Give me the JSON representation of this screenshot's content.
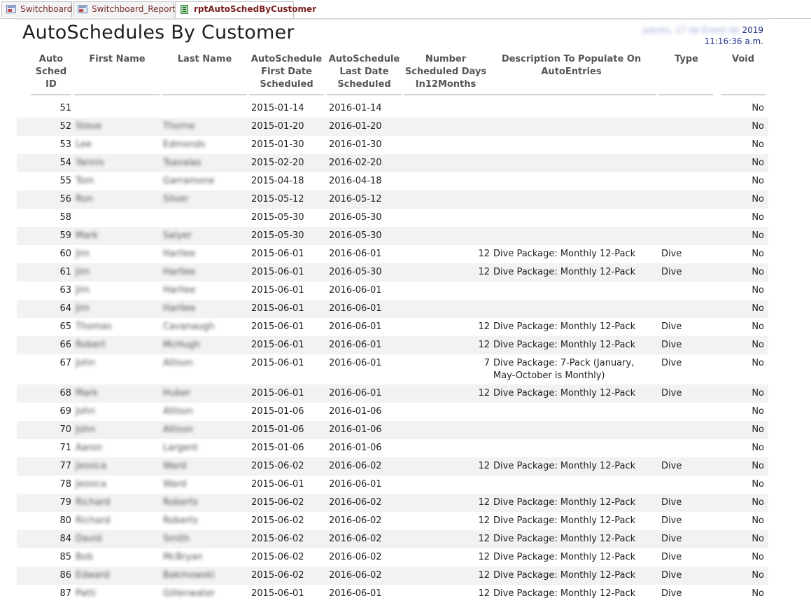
{
  "tabs": [
    {
      "label": "Switchboard",
      "type": "form"
    },
    {
      "label": "Switchboard_Reports",
      "type": "form"
    },
    {
      "label": "rptAutoSchedByCustomer",
      "type": "report",
      "active": true
    }
  ],
  "report": {
    "title": "AutoSchedules By Customer",
    "date_year": "2019",
    "date_blurred": "jueves, 17 de Enero de",
    "time": "11:16:36 a.m."
  },
  "columns": {
    "id": [
      "Auto",
      "Sched",
      "ID"
    ],
    "first": [
      "First Name"
    ],
    "last": [
      "Last Name"
    ],
    "first_date": [
      "AutoSchedule",
      "First Date",
      "Scheduled"
    ],
    "last_date": [
      "AutoSchedule",
      "Last Date",
      "Scheduled"
    ],
    "days": [
      "Number",
      "Scheduled Days",
      "In12Months"
    ],
    "desc": [
      "Description To Populate On",
      "AutoEntries"
    ],
    "type": [
      "Type"
    ],
    "void": [
      "Void"
    ]
  },
  "rows": [
    {
      "id": "51",
      "first": "",
      "last": "",
      "d1": "2015-01-14",
      "d2": "2016-01-14",
      "days": "",
      "desc": "",
      "type": "",
      "void": "No"
    },
    {
      "id": "52",
      "first": "Steve",
      "last": "Thorne",
      "d1": "2015-01-20",
      "d2": "2016-01-20",
      "days": "",
      "desc": "",
      "type": "",
      "void": "No"
    },
    {
      "id": "53",
      "first": "Lee",
      "last": "Edmonds",
      "d1": "2015-01-30",
      "d2": "2016-01-30",
      "days": "",
      "desc": "",
      "type": "",
      "void": "No"
    },
    {
      "id": "54",
      "first": "Yannis",
      "last": "Tsavalas",
      "d1": "2015-02-20",
      "d2": "2016-02-20",
      "days": "",
      "desc": "",
      "type": "",
      "void": "No"
    },
    {
      "id": "55",
      "first": "Tom",
      "last": "Garramone",
      "d1": "2015-04-18",
      "d2": "2016-04-18",
      "days": "",
      "desc": "",
      "type": "",
      "void": "No"
    },
    {
      "id": "56",
      "first": "Ron",
      "last": "Silver",
      "d1": "2015-05-12",
      "d2": "2016-05-12",
      "days": "",
      "desc": "",
      "type": "",
      "void": "No"
    },
    {
      "id": "58",
      "first": "",
      "last": "",
      "d1": "2015-05-30",
      "d2": "2016-05-30",
      "days": "",
      "desc": "",
      "type": "",
      "void": "No"
    },
    {
      "id": "59",
      "first": "Mark",
      "last": "Salyer",
      "d1": "2015-05-30",
      "d2": "2016-05-30",
      "days": "",
      "desc": "",
      "type": "",
      "void": "No"
    },
    {
      "id": "60",
      "first": "Jim",
      "last": "Harllee",
      "d1": "2015-06-01",
      "d2": "2016-06-01",
      "days": "12",
      "desc": "Dive Package: Monthly 12-Pack",
      "type": "Dive",
      "void": "No"
    },
    {
      "id": "61",
      "first": "Jim",
      "last": "Harllee",
      "d1": "2015-06-01",
      "d2": "2016-05-30",
      "days": "12",
      "desc": "Dive Package: Monthly 12-Pack",
      "type": "Dive",
      "void": "No"
    },
    {
      "id": "63",
      "first": "Jim",
      "last": "Harllee",
      "d1": "2015-06-01",
      "d2": "2016-06-01",
      "days": "",
      "desc": "",
      "type": "",
      "void": "No"
    },
    {
      "id": "64",
      "first": "Jim",
      "last": "Harllee",
      "d1": "2015-06-01",
      "d2": "2016-06-01",
      "days": "",
      "desc": "",
      "type": "",
      "void": "No"
    },
    {
      "id": "65",
      "first": "Thomas",
      "last": "Cavanaugh",
      "d1": "2015-06-01",
      "d2": "2016-06-01",
      "days": "12",
      "desc": "Dive Package: Monthly 12-Pack",
      "type": "Dive",
      "void": "No"
    },
    {
      "id": "66",
      "first": "Robert",
      "last": "McHugh",
      "d1": "2015-06-01",
      "d2": "2016-06-01",
      "days": "12",
      "desc": "Dive Package: Monthly 12-Pack",
      "type": "Dive",
      "void": "No"
    },
    {
      "id": "67",
      "first": "John",
      "last": "Allison",
      "d1": "2015-06-01",
      "d2": "2016-06-01",
      "days": "7",
      "desc": "Dive Package: 7-Pack (January, May-October is Monthly)",
      "type": "Dive",
      "void": "No",
      "tall": true
    },
    {
      "id": "68",
      "first": "Mark",
      "last": "Huber",
      "d1": "2015-06-01",
      "d2": "2016-06-01",
      "days": "12",
      "desc": "Dive Package: Monthly 12-Pack",
      "type": "Dive",
      "void": "No"
    },
    {
      "id": "69",
      "first": "John",
      "last": "Allison",
      "d1": "2015-01-06",
      "d2": "2016-01-06",
      "days": "",
      "desc": "",
      "type": "",
      "void": "No"
    },
    {
      "id": "70",
      "first": "John",
      "last": "Allison",
      "d1": "2015-01-06",
      "d2": "2016-01-06",
      "days": "",
      "desc": "",
      "type": "",
      "void": "No"
    },
    {
      "id": "71",
      "first": "Aaron",
      "last": "Largent",
      "d1": "2015-01-06",
      "d2": "2016-01-06",
      "days": "",
      "desc": "",
      "type": "",
      "void": "No"
    },
    {
      "id": "77",
      "first": "Jessica",
      "last": "Ward",
      "d1": "2015-06-02",
      "d2": "2016-06-02",
      "days": "12",
      "desc": "Dive Package: Monthly 12-Pack",
      "type": "Dive",
      "void": "No"
    },
    {
      "id": "78",
      "first": "Jessica",
      "last": "Ward",
      "d1": "2015-06-01",
      "d2": "2016-06-01",
      "days": "",
      "desc": "",
      "type": "",
      "void": "No"
    },
    {
      "id": "79",
      "first": "Richard",
      "last": "Roberts",
      "d1": "2015-06-02",
      "d2": "2016-06-02",
      "days": "12",
      "desc": "Dive Package: Monthly 12-Pack",
      "type": "Dive",
      "void": "No"
    },
    {
      "id": "80",
      "first": "Richard",
      "last": "Roberts",
      "d1": "2015-06-02",
      "d2": "2016-06-02",
      "days": "12",
      "desc": "Dive Package: Monthly 12-Pack",
      "type": "Dive",
      "void": "No"
    },
    {
      "id": "84",
      "first": "David",
      "last": "Smith",
      "d1": "2015-06-02",
      "d2": "2016-06-02",
      "days": "12",
      "desc": "Dive Package: Monthly 12-Pack",
      "type": "Dive",
      "void": "No"
    },
    {
      "id": "85",
      "first": "Bob",
      "last": "McBryan",
      "d1": "2015-06-02",
      "d2": "2016-06-02",
      "days": "12",
      "desc": "Dive Package: Monthly 12-Pack",
      "type": "Dive",
      "void": "No"
    },
    {
      "id": "86",
      "first": "Edward",
      "last": "Bakmowski",
      "d1": "2015-06-02",
      "d2": "2016-06-02",
      "days": "12",
      "desc": "Dive Package: Monthly 12-Pack",
      "type": "Dive",
      "void": "No"
    },
    {
      "id": "87",
      "first": "Patti",
      "last": "Gillenwater",
      "d1": "2015-06-01",
      "d2": "2016-06-01",
      "days": "12",
      "desc": "Dive Package: Monthly 12-Pack",
      "type": "Dive",
      "void": "No"
    }
  ]
}
